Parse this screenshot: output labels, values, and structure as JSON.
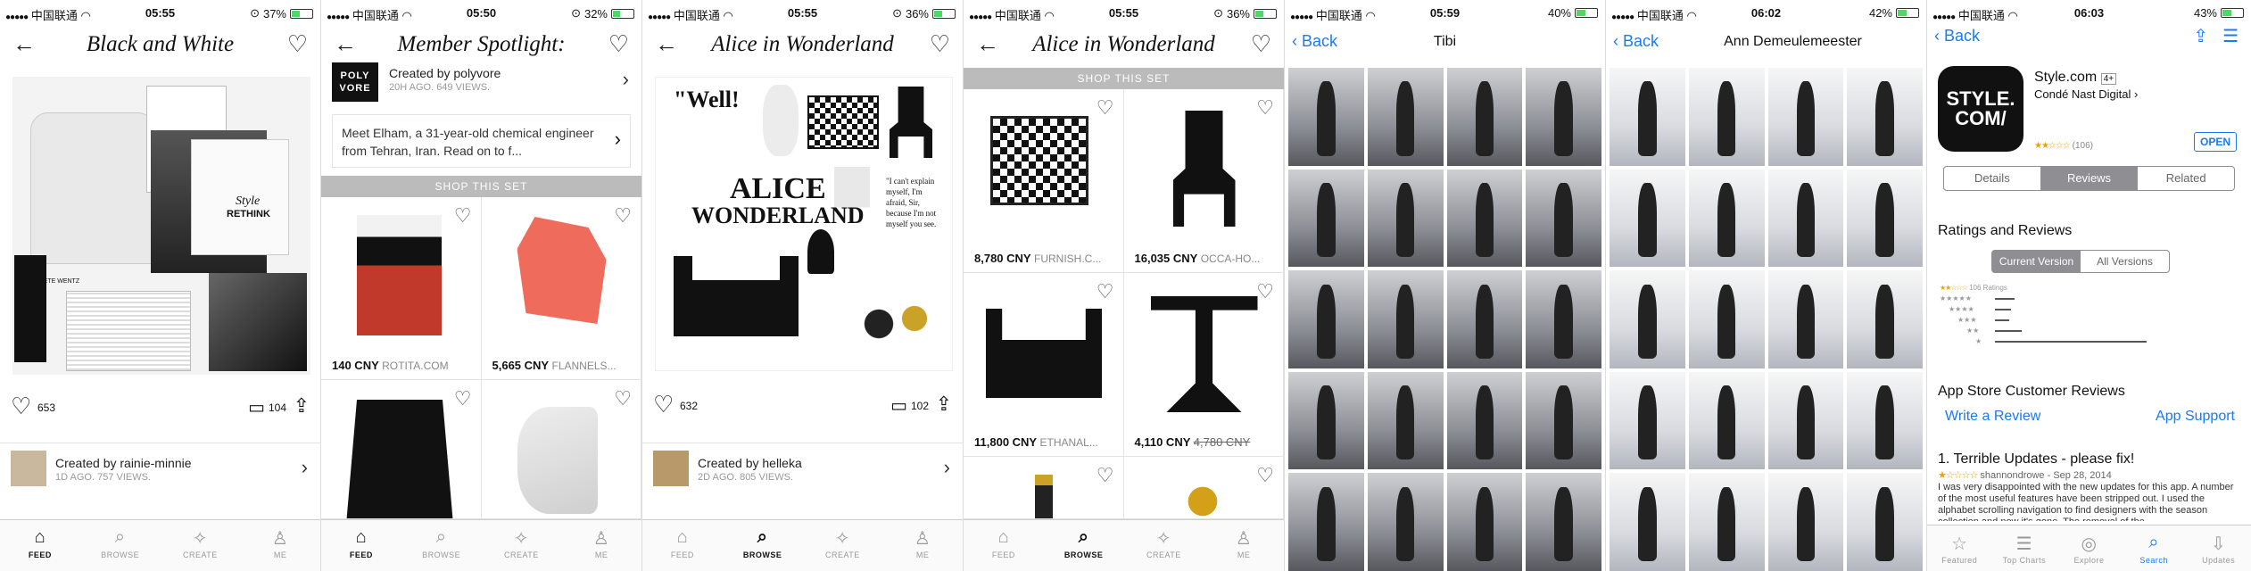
{
  "status_bars": [
    {
      "carrier": "中国联通",
      "time": "05:55",
      "battery": "37%",
      "battery_level": 0.37
    },
    {
      "carrier": "中国联通",
      "time": "05:50",
      "battery": "32%",
      "battery_level": 0.32
    },
    {
      "carrier": "中国联通",
      "time": "05:55",
      "battery": "36%",
      "battery_level": 0.36
    },
    {
      "carrier": "中国联通",
      "time": "05:55",
      "battery": "36%",
      "battery_level": 0.36
    },
    {
      "carrier": "中国联通",
      "time": "05:59",
      "battery": "40%",
      "battery_level": 0.4
    },
    {
      "carrier": "中国联通",
      "time": "06:02",
      "battery": "42%",
      "battery_level": 0.42
    },
    {
      "carrier": "中国联通",
      "time": "06:03",
      "battery": "43%",
      "battery_level": 0.43
    }
  ],
  "tabs": [
    {
      "label": "FEED",
      "icon": "home-icon"
    },
    {
      "label": "BROWSE",
      "icon": "search-icon"
    },
    {
      "label": "CREATE",
      "icon": "magic-wand-icon"
    },
    {
      "label": "ME",
      "icon": "person-icon"
    }
  ],
  "screen1": {
    "title": "Black and White",
    "likes": "653",
    "comments": "104",
    "creator_line": "Created by rainie-minnie",
    "creator_meta": "1D AGO. 757 VIEWS.",
    "collage_text_1": "Style",
    "collage_text_2": "RETHINK",
    "collage_text_3": "PETE WENTZ"
  },
  "screen2": {
    "title": "Member Spotlight:",
    "logo_line1": "POLY",
    "logo_line2": "VORE",
    "creator_line": "Created by polyvore",
    "creator_meta": "20H AGO. 649 VIEWS.",
    "description": "Meet Elham, a 31-year-old chemical engineer from Tehran, Iran. Read on to f...",
    "shop_label": "SHOP THIS SET",
    "products": [
      {
        "price": "140 CNY",
        "store": "ROTITA.COM"
      },
      {
        "price": "5,665 CNY",
        "store": "FLANNELS..."
      },
      {
        "price": "",
        "store": ""
      },
      {
        "price": "",
        "store": ""
      }
    ]
  },
  "screen3": {
    "title": "Alice in Wonderland",
    "quote_well": "\"Well!",
    "logo_line1": "ALICE",
    "logo_line2": "WONDERLAND",
    "quote_right": "\"I can't explain myself, I'm afraid, Sir, because I'm not myself you see.",
    "likes": "632",
    "comments": "102",
    "creator_line": "Created by helleka",
    "creator_meta": "2D AGO. 805 VIEWS."
  },
  "screen4": {
    "title": "Alice in Wonderland",
    "shop_label": "SHOP THIS SET",
    "products": [
      {
        "price": "8,780 CNY",
        "store": "FURNISH.C...",
        "old_price": ""
      },
      {
        "price": "16,035 CNY",
        "store": "OCCA-HO...",
        "old_price": ""
      },
      {
        "price": "11,800 CNY",
        "store": "ETHANAL...",
        "old_price": ""
      },
      {
        "price": "4,110 CNY",
        "store": "",
        "old_price": "4,780 CNY"
      }
    ]
  },
  "screen5": {
    "back_label": "Back",
    "title": "Tibi",
    "photo_count": 20
  },
  "screen6": {
    "back_label": "Back",
    "title": "Ann Demeulemeester",
    "photo_count": 20
  },
  "screen7": {
    "back_label": "Back",
    "app_icon_text": "STYLE. COM/",
    "app_name": "Style.com",
    "age_badge": "4+",
    "developer": "Condé Nast Digital",
    "rating_count": "(106)",
    "open_label": "OPEN",
    "segments": [
      "Details",
      "Reviews",
      "Related"
    ],
    "active_segment": "Reviews",
    "ratings_header": "Ratings and Reviews",
    "version_tabs": [
      "Current Version",
      "All Versions"
    ],
    "active_version_tab": "Current Version",
    "total_ratings": "106 Ratings",
    "star_breakdown": [
      {
        "stars": "★★★★★",
        "fraction": 0.08
      },
      {
        "stars": "★★★★",
        "fraction": 0.07
      },
      {
        "stars": "★★★",
        "fraction": 0.06
      },
      {
        "stars": "★★",
        "fraction": 0.12
      },
      {
        "stars": "★",
        "fraction": 0.7
      }
    ],
    "customer_reviews_header": "App Store Customer Reviews",
    "write_review": "Write a Review",
    "app_support": "App Support",
    "review_title": "1. Terrible Updates - please fix!",
    "review_author": "shannondrowe - Sep 28, 2014",
    "review_body": "I was very disappointed with the new updates for this app. A number of the most useful features have been stripped out. I used the alphabet scrolling navigation to find designers with the season collection and now it's gone. The removal of the",
    "tabs": [
      {
        "label": "Featured",
        "icon": "star-icon"
      },
      {
        "label": "Top Charts",
        "icon": "list-icon"
      },
      {
        "label": "Explore",
        "icon": "compass-icon"
      },
      {
        "label": "Search",
        "icon": "search-icon"
      },
      {
        "label": "Updates",
        "icon": "download-icon"
      }
    ],
    "active_tab": "Search"
  }
}
